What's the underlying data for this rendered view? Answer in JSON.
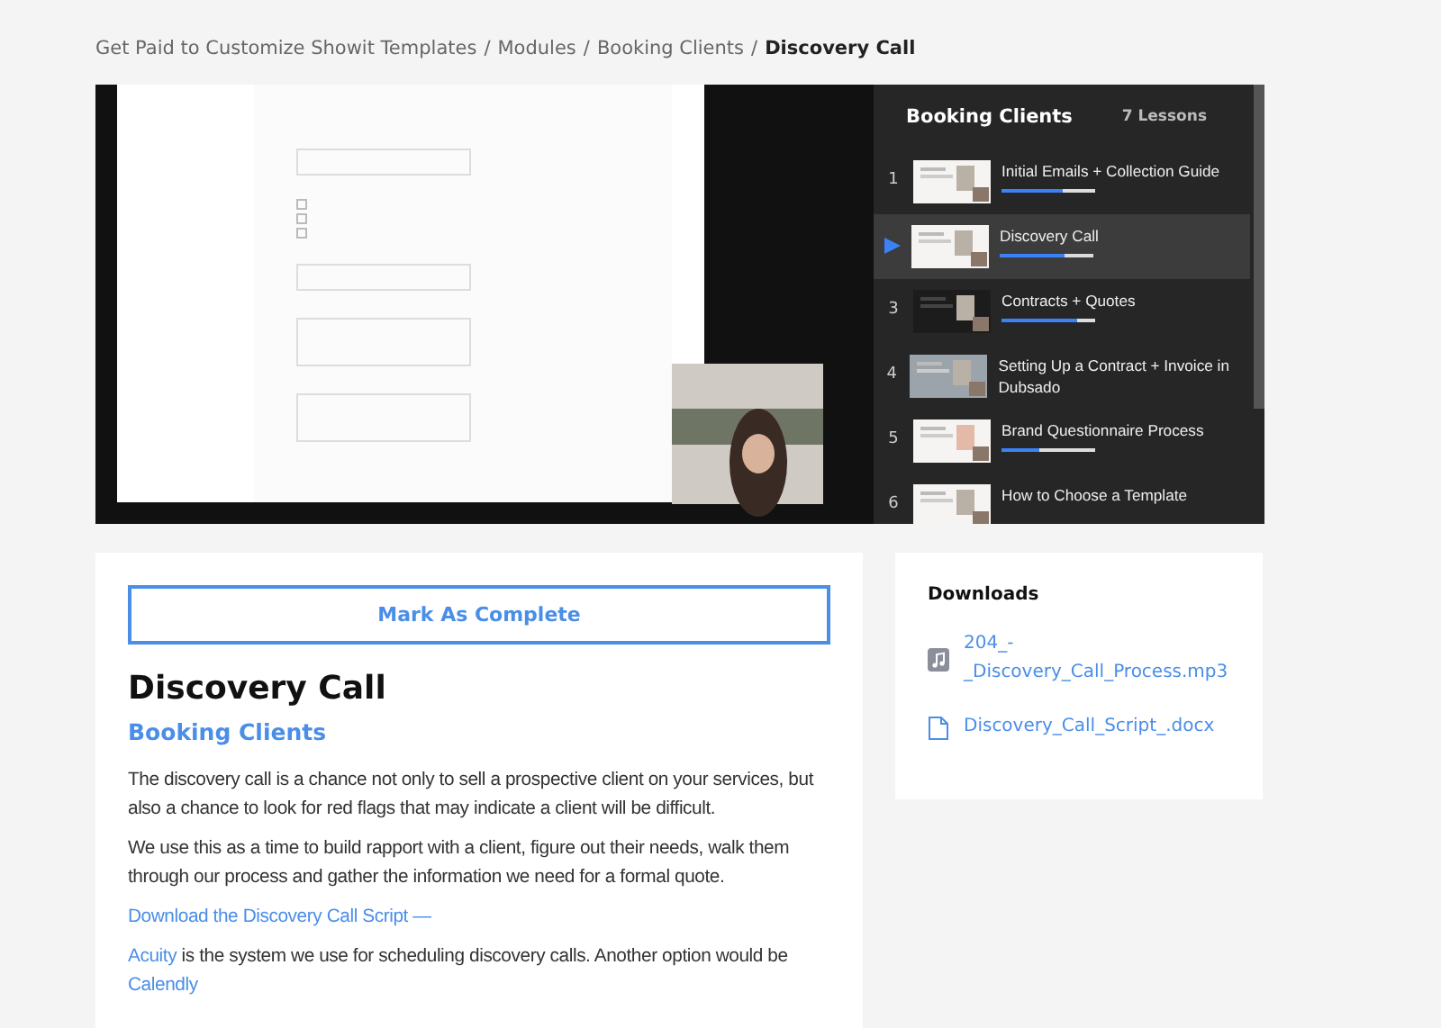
{
  "breadcrumb": [
    {
      "label": "Get Paid to Customize Showit Templates",
      "current": false
    },
    {
      "label": "Modules",
      "current": false
    },
    {
      "label": "Booking Clients",
      "current": false
    },
    {
      "label": "Discovery Call",
      "current": true
    }
  ],
  "separator": "/",
  "playlist": {
    "title": "Booking Clients",
    "count": "7 Lessons",
    "lessons": [
      {
        "number": "1",
        "title": "Initial Emails + Collection Guide",
        "selected": false,
        "level": 0.65
      },
      {
        "title": "Discovery Call",
        "selected": true,
        "level": 0.7
      },
      {
        "number": "3",
        "title": "Contracts + Quotes",
        "selected": false,
        "level": 0.8
      },
      {
        "number": "4",
        "title": "Setting Up a Contract + Invoice in Dubsado",
        "selected": false
      },
      {
        "number": "5",
        "title": "Brand Questionnaire Process",
        "selected": false,
        "level": 0.4
      },
      {
        "number": "6",
        "title": "How to Choose a Template",
        "selected": false
      }
    ]
  },
  "complete_button": "Mark As Complete",
  "lesson": {
    "title": "Discovery Call",
    "module": "Booking Clients",
    "blocks": [
      {
        "kind": "text",
        "text": "The discovery call is a chance not only to sell a prospective client on your services, but also a chance to look for red flags that may indicate a client will be difficult."
      },
      {
        "kind": "text",
        "text": "We use this as a time to build rapport with a client, figure out their needs, walk them through our process and gather the information we need for a formal quote."
      },
      {
        "kind": "link",
        "text": "Download the Discovery Call Script —"
      },
      {
        "kind": "mixed",
        "link": "Acuity",
        "text": " is the system we use for scheduling discovery calls. Another option would be ",
        "link2": "Calendly"
      }
    ]
  },
  "downloads": {
    "title": "Downloads",
    "files": [
      {
        "kind": "audio",
        "name": "204_-_Discovery_Call_Process.mp3"
      },
      {
        "kind": "document",
        "name": "Discovery_Call_Script_.docx"
      }
    ]
  }
}
